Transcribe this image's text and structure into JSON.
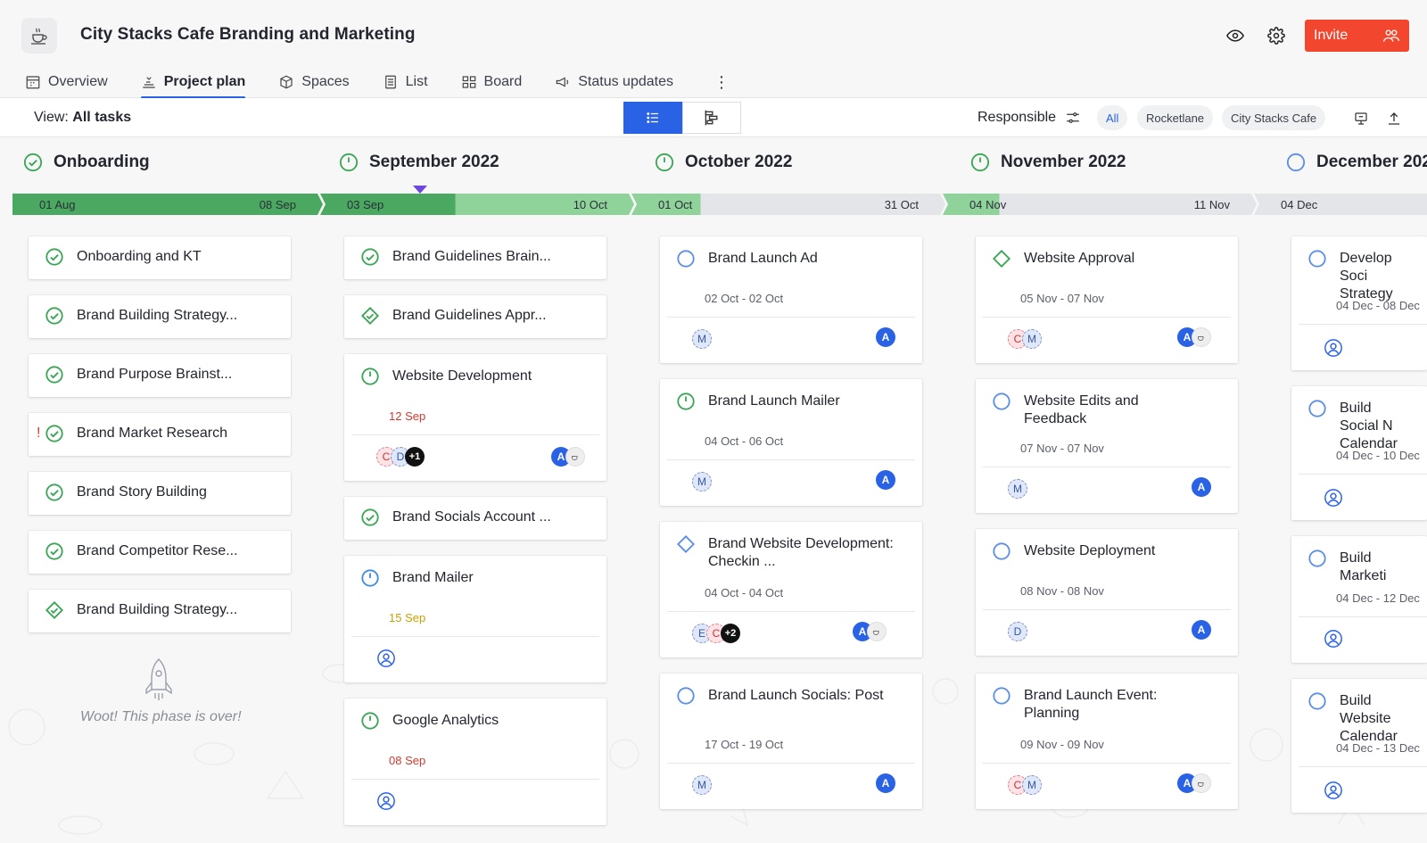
{
  "header": {
    "project_title": "City Stacks Cafe Branding and Marketing",
    "invite_label": "Invite",
    "accent_color": "#f2462e"
  },
  "tabs": [
    {
      "label": "Overview",
      "icon": "calendar-grid-icon"
    },
    {
      "label": "Project plan",
      "icon": "plan-stack-icon",
      "active": true
    },
    {
      "label": "Spaces",
      "icon": "cube-icon"
    },
    {
      "label": "List",
      "icon": "list-doc-icon"
    },
    {
      "label": "Board",
      "icon": "board-icon"
    },
    {
      "label": "Status updates",
      "icon": "megaphone-icon"
    }
  ],
  "viewbar": {
    "view_prefix": "View:",
    "view_value": "All tasks",
    "responsible_label": "Responsible",
    "chips": [
      "All",
      "Rocketlane",
      "City Stacks Cafe"
    ]
  },
  "phases": [
    {
      "name": "Onboarding",
      "start": "01 Aug",
      "end": "08 Sep"
    },
    {
      "name": "September 2022",
      "start": "03 Sep",
      "end": "10 Oct"
    },
    {
      "name": "October 2022",
      "start": "01 Oct",
      "end": "31 Oct"
    },
    {
      "name": "November 2022",
      "start": "04 Nov",
      "end": "11 Nov"
    },
    {
      "name": "December 202",
      "start": "04 Dec",
      "end": ""
    }
  ],
  "columns": [
    {
      "cards": [
        {
          "title": "Onboarding and KT"
        },
        {
          "title": "Brand Building Strategy..."
        },
        {
          "title": "Brand Purpose Brainst..."
        },
        {
          "title": "Brand Market Research",
          "flag": "!"
        },
        {
          "title": "Brand Story Building"
        },
        {
          "title": "Brand Competitor Rese..."
        },
        {
          "title": "Brand Building Strategy..."
        }
      ],
      "phase_over": "Woot! This phase is over!"
    },
    {
      "cards": [
        {
          "title": "Brand Guidelines Brain..."
        },
        {
          "title": "Brand Guidelines Appr..."
        },
        {
          "title": "Website Development",
          "date": "12 Sep",
          "avatars": [
            "C",
            "D",
            "+1"
          ]
        },
        {
          "title": "Brand Socials Account ..."
        },
        {
          "title": "Brand Mailer",
          "date": "15 Sep"
        },
        {
          "title": "Google Analytics",
          "date": "08 Sep"
        }
      ]
    },
    {
      "cards": [
        {
          "title": "Brand Launch Ad",
          "date": "02 Oct - 02 Oct",
          "avatars": [
            "M"
          ],
          "owner": "A"
        },
        {
          "title": "Brand Launch Mailer",
          "date": "04 Oct - 06 Oct",
          "avatars": [
            "M"
          ],
          "owner": "A"
        },
        {
          "title": "Brand Website Development: Checkin ...",
          "date": "04 Oct - 04 Oct",
          "avatars": [
            "E",
            "C",
            "+2"
          ],
          "owner": "A"
        },
        {
          "title": "Brand Launch Socials: Post",
          "date": "17 Oct - 19 Oct",
          "avatars": [
            "M"
          ],
          "owner": "A"
        }
      ]
    },
    {
      "cards": [
        {
          "title": "Website Approval",
          "date": "05 Nov - 07 Nov",
          "avatars": [
            "C",
            "M"
          ],
          "owner": "A"
        },
        {
          "title": "Website Edits and Feedback",
          "date": "07 Nov - 07 Nov",
          "avatars": [
            "M"
          ],
          "owner": "A"
        },
        {
          "title": "Website Deployment",
          "date": "08 Nov - 08 Nov",
          "avatars": [
            "D"
          ],
          "owner": "A"
        },
        {
          "title": "Brand Launch Event: Planning",
          "date": "09 Nov - 09 Nov",
          "avatars": [
            "C",
            "M"
          ],
          "owner": "A"
        }
      ]
    },
    {
      "cards": [
        {
          "title": "Develop Soci",
          "title2": "Strategy",
          "date": "04 Dec - 08 Dec"
        },
        {
          "title": "Build Social N",
          "title2": "Calendar",
          "date": "04 Dec - 10 Dec"
        },
        {
          "title": "Build Marketi",
          "date": "04 Dec - 12 Dec"
        },
        {
          "title": "Build Website",
          "title2": "Calendar",
          "date": "04 Dec - 13 Dec"
        }
      ]
    }
  ]
}
